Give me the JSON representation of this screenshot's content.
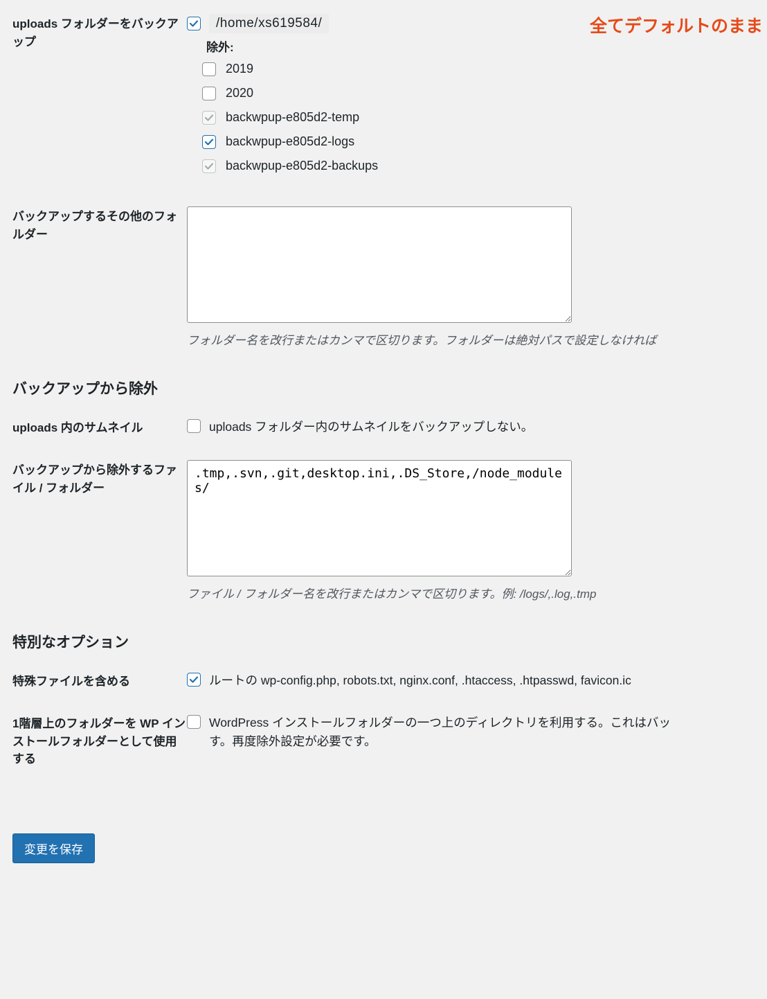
{
  "uploads": {
    "label": "uploads フォルダーをバックアップ",
    "checked": true,
    "path": "/home/xs619584/",
    "annotation": "全てデフォルトのまま",
    "exclude_label": "除外:",
    "items": [
      {
        "name": "2019",
        "checked": false,
        "disabled": false
      },
      {
        "name": "2020",
        "checked": false,
        "disabled": false
      },
      {
        "name": "backwpup-e805d2-temp",
        "checked": true,
        "disabled": true
      },
      {
        "name": "backwpup-e805d2-logs",
        "checked": true,
        "disabled": false
      },
      {
        "name": "backwpup-e805d2-backups",
        "checked": true,
        "disabled": true
      }
    ]
  },
  "extra_folders": {
    "label": "バックアップするその他のフォルダー",
    "value": "",
    "help": "フォルダー名を改行またはカンマで区切ります。フォルダーは絶対パスで設定しなければ"
  },
  "exclude_section_heading": "バックアップから除外",
  "thumbnails": {
    "label": "uploads 内のサムネイル",
    "checked": false,
    "text": "uploads フォルダー内のサムネイルをバックアップしない。"
  },
  "exclude_files": {
    "label": "バックアップから除外するファイル / フォルダー",
    "value": ".tmp,.svn,.git,desktop.ini,.DS_Store,/node_modules/",
    "help": "ファイル / フォルダー名を改行またはカンマで区切ります。例: /logs/,.log,.tmp"
  },
  "special_section_heading": "特別なオプション",
  "special_files": {
    "label": "特殊ファイルを含める",
    "checked": true,
    "text": "ルートの wp-config.php, robots.txt, nginx.conf, .htaccess, .htpasswd, favicon.ic"
  },
  "one_up": {
    "label": "1階層上のフォルダーを WP インストールフォルダーとして使用する",
    "checked": false,
    "text": "WordPress インストールフォルダーの一つ上のディレクトリを利用する。これはバッ\nす。再度除外設定が必要です。"
  },
  "save_button": "変更を保存"
}
